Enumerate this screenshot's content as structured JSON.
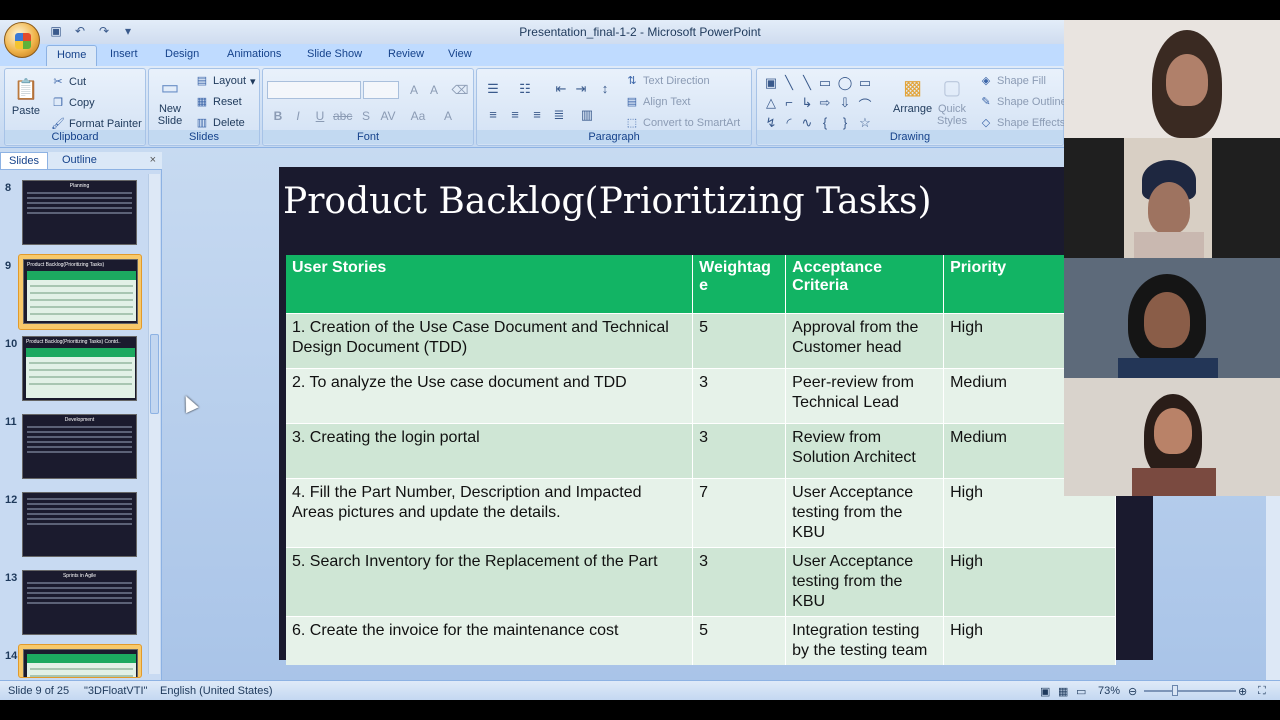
{
  "window": {
    "title": "Presentation_final-1-2 - Microsoft PowerPoint"
  },
  "ribbon_tabs": [
    "Home",
    "Insert",
    "Design",
    "Animations",
    "Slide Show",
    "Review",
    "View"
  ],
  "clipboard": {
    "paste": "Paste",
    "cut": "Cut",
    "copy": "Copy",
    "format_painter": "Format Painter",
    "label": "Clipboard"
  },
  "slides_group": {
    "new_slide": "New",
    "new_slide2": "Slide",
    "layout": "Layout",
    "reset": "Reset",
    "delete": "Delete",
    "label": "Slides"
  },
  "font_group": {
    "label": "Font"
  },
  "paragraph_group": {
    "text_direction": "Text Direction",
    "align_text": "Align Text",
    "convert_smartart": "Convert to SmartArt",
    "label": "Paragraph"
  },
  "drawing_group": {
    "arrange": "Arrange",
    "quick_styles": "Quick",
    "quick_styles2": "Styles",
    "shape_fill": "Shape Fill",
    "shape_outline": "Shape Outline",
    "shape_effects": "Shape Effects",
    "label": "Drawing"
  },
  "panel": {
    "tab_slides": "Slides",
    "tab_outline": "Outline",
    "close": "×",
    "thumbnails": [
      {
        "num": "8",
        "title": "Planning",
        "selected": false
      },
      {
        "num": "9",
        "title": "Product Backlog(Prioritizing Tasks)",
        "selected": true
      },
      {
        "num": "10",
        "title": "Product Backlog(Prioritizing Tasks) Contd..",
        "selected": false
      },
      {
        "num": "11",
        "title": "Development",
        "selected": false
      },
      {
        "num": "12",
        "title": "",
        "selected": false
      },
      {
        "num": "13",
        "title": "Sprints in Agile",
        "selected": false
      },
      {
        "num": "14",
        "title": "",
        "selected": false
      }
    ]
  },
  "slide": {
    "title": "Product Backlog(Prioritizing Tasks)",
    "headers": [
      "User Stories",
      "Weightag e",
      "Acceptance Criteria",
      "Priority"
    ],
    "rows": [
      [
        "1. Creation of the Use Case Document and Technical Design Document (TDD)",
        "5",
        "Approval from the Customer head",
        "High"
      ],
      [
        "2. To analyze the Use case document and TDD",
        "3",
        "Peer-review from Technical Lead",
        "Medium"
      ],
      [
        "3. Creating the login portal",
        "3",
        "Review from Solution Architect",
        "Medium"
      ],
      [
        "4.  Fill the Part Number, Description and Impacted Areas pictures and update the details.",
        "7",
        "User Acceptance testing from the KBU",
        "High"
      ],
      [
        "5.  Search Inventory for the Replacement of the Part",
        "3",
        "User Acceptance testing from the KBU",
        "High"
      ],
      [
        "6.  Create the invoice for the maintenance cost",
        "5",
        "Integration testing by the testing team",
        "High"
      ]
    ]
  },
  "statusbar": {
    "slide_of": "Slide 9 of 25",
    "theme": "\"3DFloatVTI\"",
    "language": "English (United States)",
    "zoom": "73%"
  },
  "colors": {
    "header_green": "#12b464",
    "slide_bg": "#1a1a2e",
    "row_odd": "#cfe6d5",
    "row_even": "#e6f2e9"
  }
}
